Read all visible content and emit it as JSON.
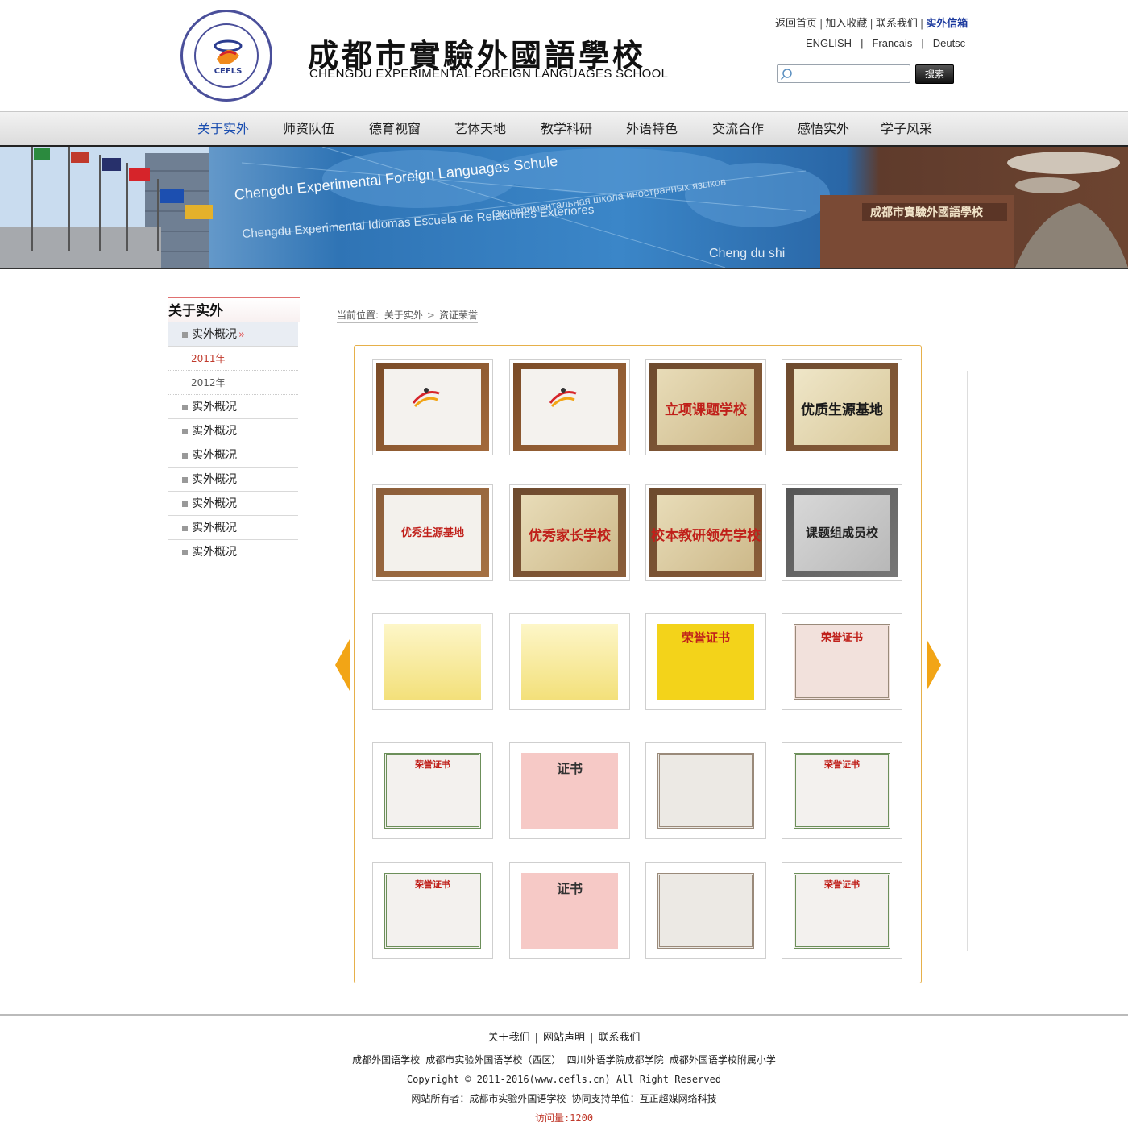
{
  "header": {
    "logo_text": "CEFLS",
    "school_name_cn": "成都市實驗外國語學校",
    "school_name_en": "CHENGDU EXPERIMENTAL FOREIGN LANGUAGES SCHOOL",
    "top_links": [
      "返回首页",
      "加入收藏",
      "联系我们",
      "实外信箱"
    ],
    "languages": [
      "ENGLISH",
      "Francais",
      "Deutsc"
    ],
    "search": {
      "placeholder": "",
      "button_label": "搜索"
    }
  },
  "nav": {
    "items": [
      "关于实外",
      "师资队伍",
      "德育视窗",
      "艺体天地",
      "教学科研",
      "外语特色",
      "交流合作",
      "感悟实外",
      "学子风采"
    ],
    "active": "关于实外"
  },
  "banner": {
    "text_lines": [
      "Chengdu Experimental Foreign Languages Schule",
      "Chengdu Experimental Idiomas Escuela de Relaciones Exteriores",
      "Экспериментальная школа иностранных языков",
      "Cheng du shi"
    ],
    "sign_text": "成都市實驗外國語學校"
  },
  "sidebar": {
    "title": "关于实外",
    "items": [
      {
        "label": "实外概况",
        "active": true,
        "subs": [
          "2011年",
          "2012年"
        ]
      },
      {
        "label": "实外概况"
      },
      {
        "label": "实外概况"
      },
      {
        "label": "实外概况"
      },
      {
        "label": "实外概况"
      },
      {
        "label": "实外概况"
      },
      {
        "label": "实外概况"
      },
      {
        "label": "实外概况"
      }
    ]
  },
  "breadcrumb": {
    "prefix": "当前位置:",
    "level1": "关于实外",
    "level2": "资证荣誉"
  },
  "gallery": {
    "items": [
      {
        "caption": "",
        "style": "plaque-white-schulen"
      },
      {
        "caption": "",
        "style": "plaque-white-schulen"
      },
      {
        "caption": "立项课题学校",
        "style": "plaque-gold-red"
      },
      {
        "caption": "优质生源基地",
        "style": "plaque-gold-title"
      },
      {
        "caption": "优秀生源基地",
        "style": "plaque-white-red"
      },
      {
        "caption": "优秀家长学校",
        "style": "plaque-gold-red"
      },
      {
        "caption": "校本教研领先学校",
        "style": "plaque-gold-red"
      },
      {
        "caption": "课题组成员校",
        "style": "plaque-silver"
      },
      {
        "caption": "",
        "style": "cert-yellow"
      },
      {
        "caption": "",
        "style": "cert-yellow"
      },
      {
        "caption": "荣誉证书",
        "style": "cert-gold"
      },
      {
        "caption": "荣誉证书",
        "style": "cert-pink-frame"
      },
      {
        "caption": "荣誉证书",
        "style": "cert-green-frame"
      },
      {
        "caption": "证书",
        "style": "cert-pink"
      },
      {
        "caption": "",
        "style": "cert-grey-frame"
      },
      {
        "caption": "荣誉证书",
        "style": "cert-green-frame"
      },
      {
        "caption": "荣誉证书",
        "style": "cert-green-frame"
      },
      {
        "caption": "证书",
        "style": "cert-pink"
      },
      {
        "caption": "",
        "style": "cert-grey-frame"
      },
      {
        "caption": "荣誉证书",
        "style": "cert-green-frame"
      }
    ]
  },
  "footer": {
    "links": [
      "关于我们",
      "网站声明",
      "联系我们"
    ],
    "schools": "成都外国语学校 成都市实验外国语学校（西区） 四川外语学院成都学院 成都外国语学校附属小学",
    "copyright": "Copyright © 2011-2016(www.cefls.cn) All Right Reserved",
    "owner": "网站所有者：成都市实验外国语学校 协同支持单位：互正超媒网络科技",
    "visits": "访问量:1200"
  },
  "colors": {
    "accent_blue": "#1c4fb0",
    "gallery_border": "#e6b04a",
    "arrow": "#f2a516",
    "highlight_red": "#c0392b"
  }
}
